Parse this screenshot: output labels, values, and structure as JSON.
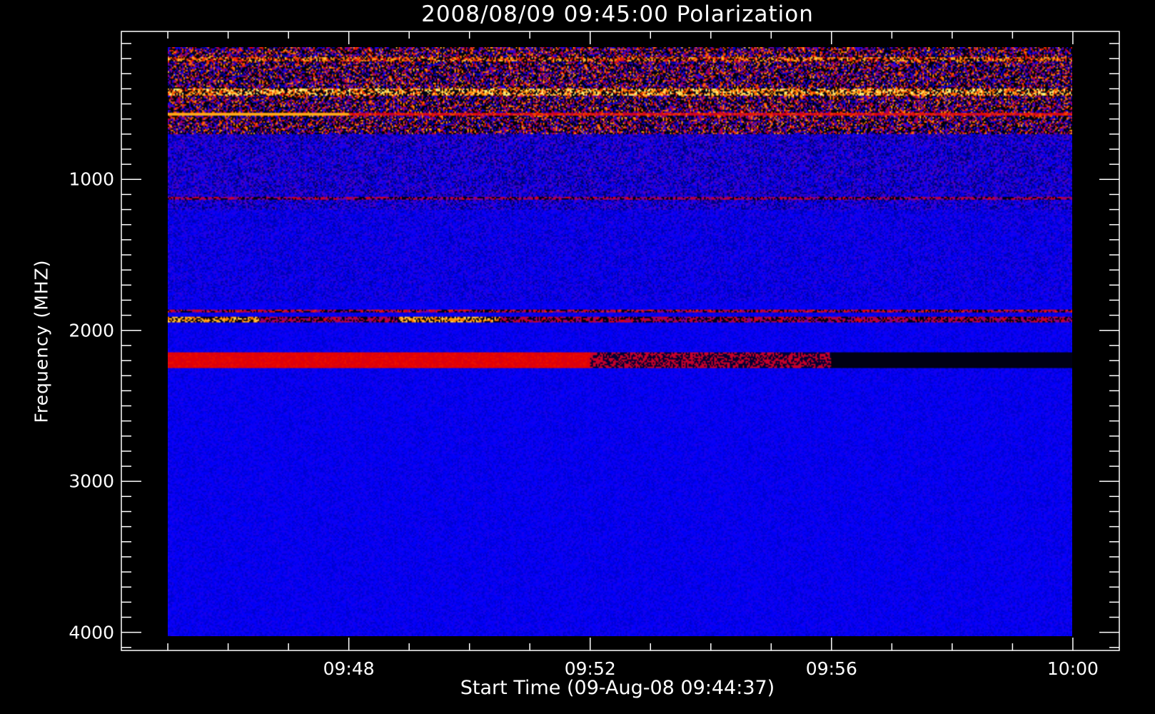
{
  "chart_data": {
    "type": "heatmap",
    "title": "2008/08/09 09:45:00 Polarization",
    "xlabel": "Start Time (09-Aug-08 09:44:37)",
    "ylabel": "Frequency (MHZ)",
    "x_unit": "minutes after 09:45:00",
    "x_range": [
      0,
      15
    ],
    "xlim": [
      -0.77,
      15.77
    ],
    "y_range_mhz": [
      130,
      4020
    ],
    "ylim": [
      20,
      4120
    ],
    "y_inverted": true,
    "x_ticks": [
      {
        "value": 3,
        "label": "09:48"
      },
      {
        "value": 7,
        "label": "09:52"
      },
      {
        "value": 11,
        "label": "09:56"
      },
      {
        "value": 15,
        "label": "10:00"
      }
    ],
    "y_ticks": [
      {
        "value": 1000,
        "label": "1000"
      },
      {
        "value": 2000,
        "label": "2000"
      },
      {
        "value": 3000,
        "label": "3000"
      },
      {
        "value": 4000,
        "label": "4000"
      }
    ],
    "colormap": [
      "#000000",
      "#0000ff",
      "#8000a0",
      "#ff0000",
      "#ffa000",
      "#ffff80"
    ],
    "background_level": 0.25,
    "features": [
      {
        "freq_mhz": 206,
        "width_mhz": 15,
        "intensity": 0.85,
        "type": "noisy band"
      },
      {
        "freq_mhz": 424,
        "width_mhz": 25,
        "intensity": 0.95,
        "type": "noisy band"
      },
      {
        "freq_mhz": 570,
        "width_mhz": 8,
        "intensity": 0.8,
        "type": "line, brighter early"
      },
      {
        "freq_mhz": 1120,
        "width_mhz": 10,
        "intensity": 0.6,
        "type": "dotted line"
      },
      {
        "freq_mhz": 1866,
        "width_mhz": 10,
        "intensity": 0.65,
        "type": "thin line"
      },
      {
        "freq_mhz": 1925,
        "width_mhz": 20,
        "intensity": 0.7,
        "type": "black/orange band"
      },
      {
        "freq_mhz": 2190,
        "width_mhz": 50,
        "intensity": 0.6,
        "type": "red band fading to black after 09:52"
      }
    ]
  }
}
